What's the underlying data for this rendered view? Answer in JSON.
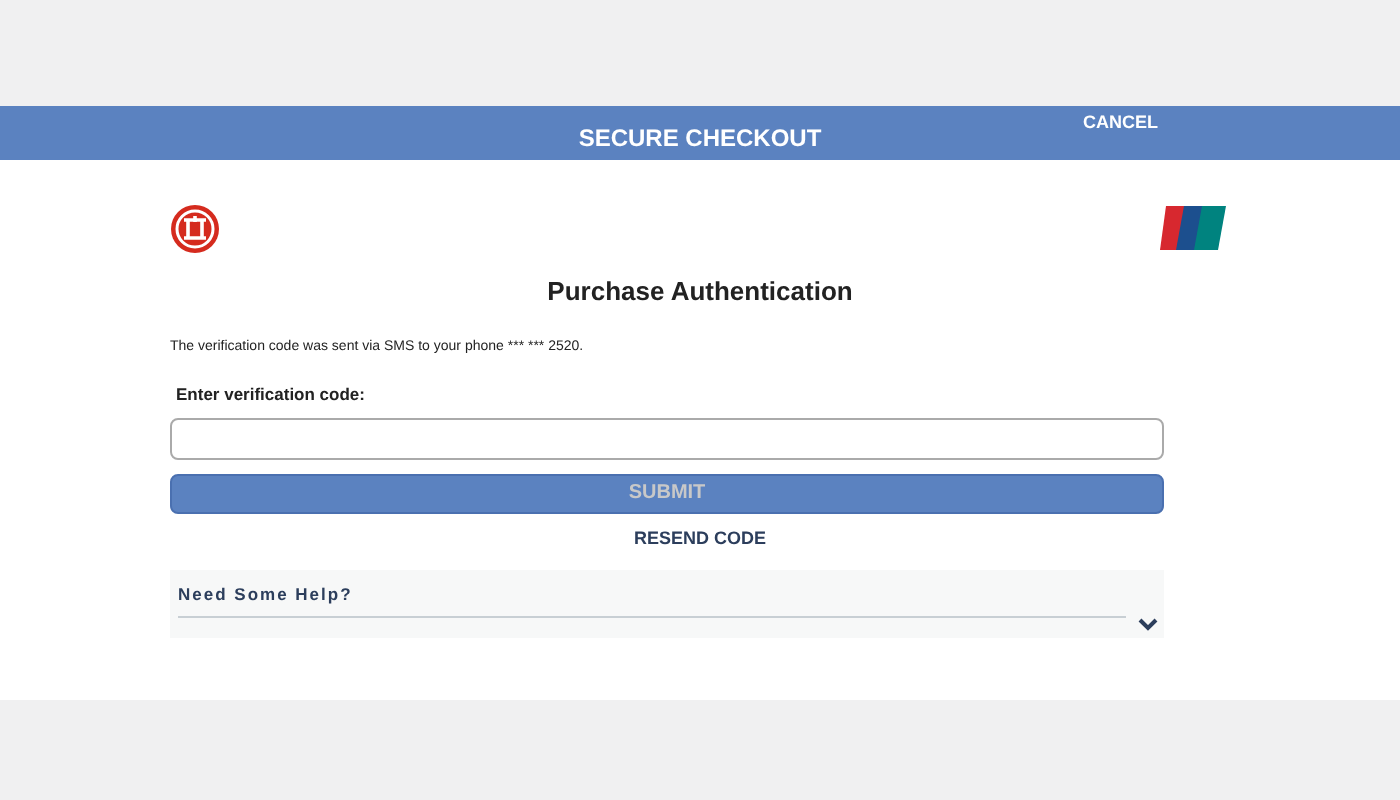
{
  "header": {
    "title": "SECURE CHECKOUT",
    "cancel": "CANCEL"
  },
  "heading": "Purchase Authentication",
  "message": "The verification code was sent via SMS to your phone *** *** 2520.",
  "code_field": {
    "label": "Enter verification code:"
  },
  "submit": {
    "label": "SUBMIT",
    "disabled": true
  },
  "resend": "RESEND CODE",
  "help": {
    "title": "Need Some Help?",
    "expanded": false
  }
}
